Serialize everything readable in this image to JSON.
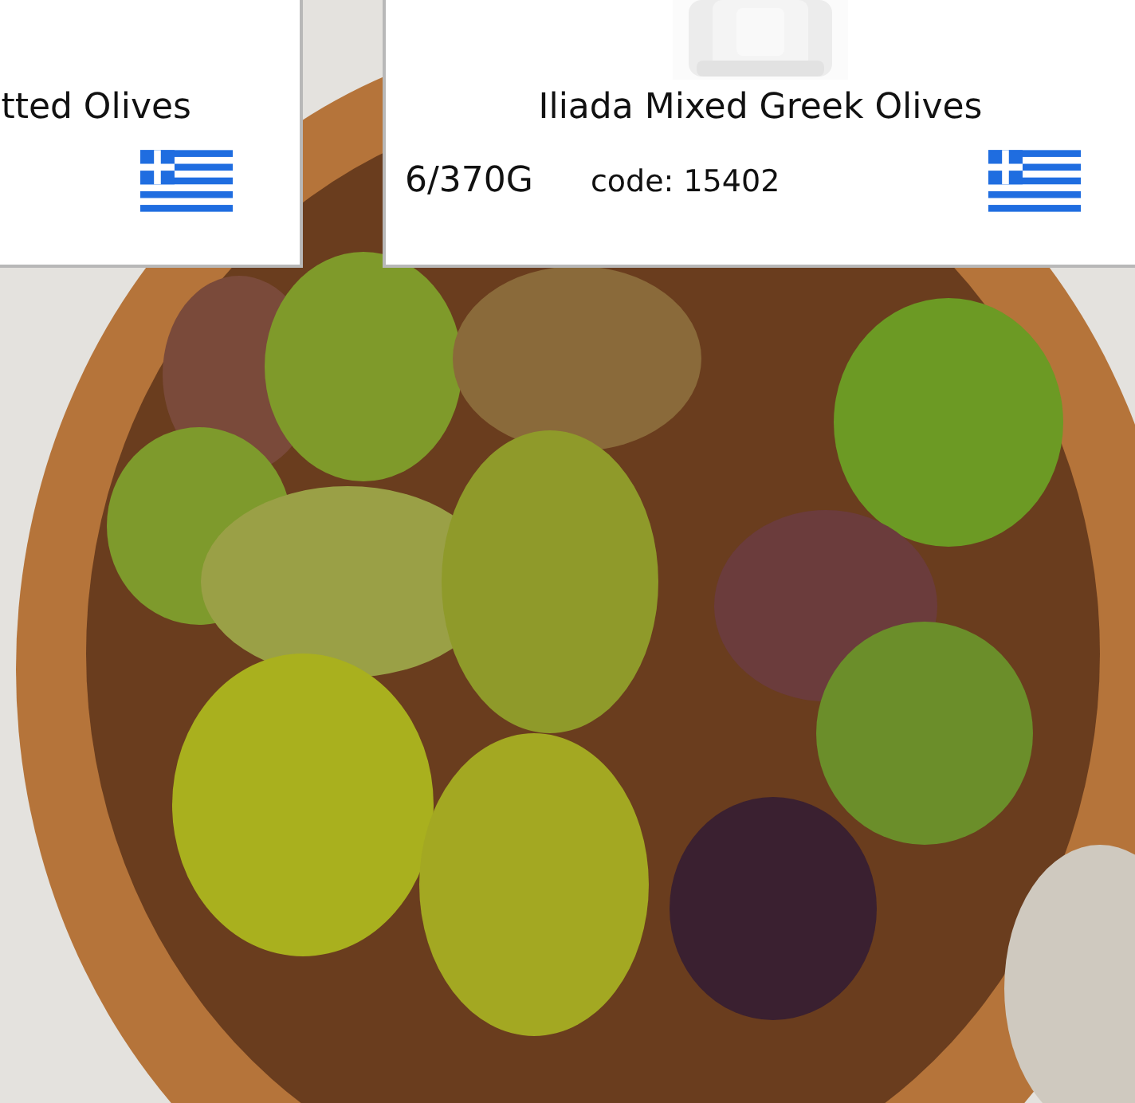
{
  "products": [
    {
      "name": "tted Olives"
    },
    {
      "name": "Iliada Mixed Greek Olives",
      "pack": "6/370G",
      "code": "code: 15402"
    }
  ]
}
